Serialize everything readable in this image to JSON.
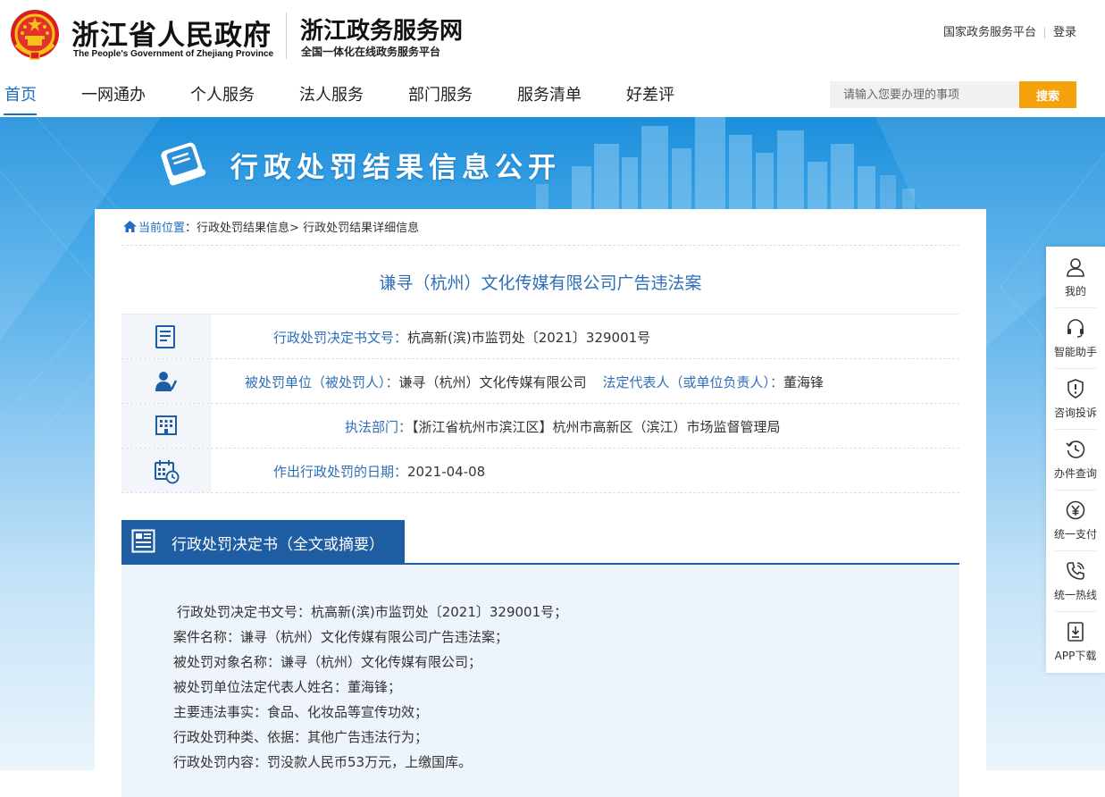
{
  "header": {
    "gov_name_cn": "浙江省人民政府",
    "gov_name_en": "The People's Government of Zhejiang Province",
    "service_name": "浙江政务服务网",
    "service_sub": "全国一体化在线政务服务平台",
    "top_links": [
      "国家政务服务平台",
      "登录"
    ]
  },
  "nav": {
    "items": [
      "首页",
      "一网通办",
      "个人服务",
      "法人服务",
      "部门服务",
      "服务清单",
      "好差评"
    ],
    "active": "首页",
    "search_placeholder": "请输入您要办理的事项",
    "search_button": "搜索"
  },
  "banner": {
    "title": "行政处罚结果信息公开"
  },
  "breadcrumb": {
    "current_label": "当前位置",
    "separator_colon": "：",
    "items": [
      "行政处罚结果信息>",
      "行政处罚结果详细信息"
    ]
  },
  "case": {
    "title": "谦寻（杭州）文化传媒有限公司广告违法案",
    "doc_number_label": "行政处罚决定书文号：",
    "doc_number": "杭高新(滨)市监罚处〔2021〕329001号",
    "punished_label": "被处罚单位（被处罚人）：",
    "punished": "谦寻（杭州）文化传媒有限公司",
    "legal_rep_label": "法定代表人（或单位负责人）：",
    "legal_rep": "董海锋",
    "dept_label": "执法部门：",
    "dept": "【浙江省杭州市滨江区】杭州市高新区（滨江）市场监督管理局",
    "date_label": "作出行政处罚的日期：",
    "date": "2021-04-08"
  },
  "decision": {
    "section_title": "行政处罚决定书（全文或摘要）",
    "lines": [
      "行政处罚决定书文号：杭高新(滨)市监罚处〔2021〕329001号；",
      "案件名称：谦寻（杭州）文化传媒有限公司广告违法案；",
      "被处罚对象名称：谦寻（杭州）文化传媒有限公司；",
      "被处罚单位法定代表人姓名：董海锋；",
      "主要违法事实：食品、化妆品等宣传功效；",
      "行政处罚种类、依据：其他广告违法行为；",
      "行政处罚内容：罚没款人民币53万元，上缴国库。"
    ]
  },
  "sidebar": {
    "items": [
      {
        "label": "我的",
        "icon": "user-icon"
      },
      {
        "label": "智能助手",
        "icon": "headset-icon"
      },
      {
        "label": "咨询投诉",
        "icon": "shield-alert-icon"
      },
      {
        "label": "办件查询",
        "icon": "history-icon"
      },
      {
        "label": "统一支付",
        "icon": "yuan-icon"
      },
      {
        "label": "统一热线",
        "icon": "phone-icon"
      },
      {
        "label": "APP下载",
        "icon": "download-icon"
      }
    ]
  },
  "colors": {
    "primary_blue": "#1e6fc0",
    "section_blue": "#1f5da3",
    "search_orange": "#f5a10c",
    "label_blue": "#2d6fb7"
  }
}
